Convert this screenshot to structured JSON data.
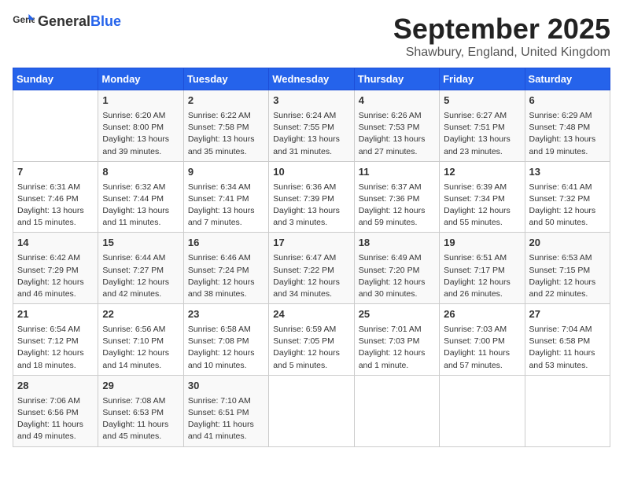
{
  "header": {
    "logo_general": "General",
    "logo_blue": "Blue",
    "month": "September 2025",
    "location": "Shawbury, England, United Kingdom"
  },
  "days_of_week": [
    "Sunday",
    "Monday",
    "Tuesday",
    "Wednesday",
    "Thursday",
    "Friday",
    "Saturday"
  ],
  "weeks": [
    [
      {
        "day": "",
        "content": ""
      },
      {
        "day": "1",
        "content": "Sunrise: 6:20 AM\nSunset: 8:00 PM\nDaylight: 13 hours\nand 39 minutes."
      },
      {
        "day": "2",
        "content": "Sunrise: 6:22 AM\nSunset: 7:58 PM\nDaylight: 13 hours\nand 35 minutes."
      },
      {
        "day": "3",
        "content": "Sunrise: 6:24 AM\nSunset: 7:55 PM\nDaylight: 13 hours\nand 31 minutes."
      },
      {
        "day": "4",
        "content": "Sunrise: 6:26 AM\nSunset: 7:53 PM\nDaylight: 13 hours\nand 27 minutes."
      },
      {
        "day": "5",
        "content": "Sunrise: 6:27 AM\nSunset: 7:51 PM\nDaylight: 13 hours\nand 23 minutes."
      },
      {
        "day": "6",
        "content": "Sunrise: 6:29 AM\nSunset: 7:48 PM\nDaylight: 13 hours\nand 19 minutes."
      }
    ],
    [
      {
        "day": "7",
        "content": "Sunrise: 6:31 AM\nSunset: 7:46 PM\nDaylight: 13 hours\nand 15 minutes."
      },
      {
        "day": "8",
        "content": "Sunrise: 6:32 AM\nSunset: 7:44 PM\nDaylight: 13 hours\nand 11 minutes."
      },
      {
        "day": "9",
        "content": "Sunrise: 6:34 AM\nSunset: 7:41 PM\nDaylight: 13 hours\nand 7 minutes."
      },
      {
        "day": "10",
        "content": "Sunrise: 6:36 AM\nSunset: 7:39 PM\nDaylight: 13 hours\nand 3 minutes."
      },
      {
        "day": "11",
        "content": "Sunrise: 6:37 AM\nSunset: 7:36 PM\nDaylight: 12 hours\nand 59 minutes."
      },
      {
        "day": "12",
        "content": "Sunrise: 6:39 AM\nSunset: 7:34 PM\nDaylight: 12 hours\nand 55 minutes."
      },
      {
        "day": "13",
        "content": "Sunrise: 6:41 AM\nSunset: 7:32 PM\nDaylight: 12 hours\nand 50 minutes."
      }
    ],
    [
      {
        "day": "14",
        "content": "Sunrise: 6:42 AM\nSunset: 7:29 PM\nDaylight: 12 hours\nand 46 minutes."
      },
      {
        "day": "15",
        "content": "Sunrise: 6:44 AM\nSunset: 7:27 PM\nDaylight: 12 hours\nand 42 minutes."
      },
      {
        "day": "16",
        "content": "Sunrise: 6:46 AM\nSunset: 7:24 PM\nDaylight: 12 hours\nand 38 minutes."
      },
      {
        "day": "17",
        "content": "Sunrise: 6:47 AM\nSunset: 7:22 PM\nDaylight: 12 hours\nand 34 minutes."
      },
      {
        "day": "18",
        "content": "Sunrise: 6:49 AM\nSunset: 7:20 PM\nDaylight: 12 hours\nand 30 minutes."
      },
      {
        "day": "19",
        "content": "Sunrise: 6:51 AM\nSunset: 7:17 PM\nDaylight: 12 hours\nand 26 minutes."
      },
      {
        "day": "20",
        "content": "Sunrise: 6:53 AM\nSunset: 7:15 PM\nDaylight: 12 hours\nand 22 minutes."
      }
    ],
    [
      {
        "day": "21",
        "content": "Sunrise: 6:54 AM\nSunset: 7:12 PM\nDaylight: 12 hours\nand 18 minutes."
      },
      {
        "day": "22",
        "content": "Sunrise: 6:56 AM\nSunset: 7:10 PM\nDaylight: 12 hours\nand 14 minutes."
      },
      {
        "day": "23",
        "content": "Sunrise: 6:58 AM\nSunset: 7:08 PM\nDaylight: 12 hours\nand 10 minutes."
      },
      {
        "day": "24",
        "content": "Sunrise: 6:59 AM\nSunset: 7:05 PM\nDaylight: 12 hours\nand 5 minutes."
      },
      {
        "day": "25",
        "content": "Sunrise: 7:01 AM\nSunset: 7:03 PM\nDaylight: 12 hours\nand 1 minute."
      },
      {
        "day": "26",
        "content": "Sunrise: 7:03 AM\nSunset: 7:00 PM\nDaylight: 11 hours\nand 57 minutes."
      },
      {
        "day": "27",
        "content": "Sunrise: 7:04 AM\nSunset: 6:58 PM\nDaylight: 11 hours\nand 53 minutes."
      }
    ],
    [
      {
        "day": "28",
        "content": "Sunrise: 7:06 AM\nSunset: 6:56 PM\nDaylight: 11 hours\nand 49 minutes."
      },
      {
        "day": "29",
        "content": "Sunrise: 7:08 AM\nSunset: 6:53 PM\nDaylight: 11 hours\nand 45 minutes."
      },
      {
        "day": "30",
        "content": "Sunrise: 7:10 AM\nSunset: 6:51 PM\nDaylight: 11 hours\nand 41 minutes."
      },
      {
        "day": "",
        "content": ""
      },
      {
        "day": "",
        "content": ""
      },
      {
        "day": "",
        "content": ""
      },
      {
        "day": "",
        "content": ""
      }
    ]
  ]
}
